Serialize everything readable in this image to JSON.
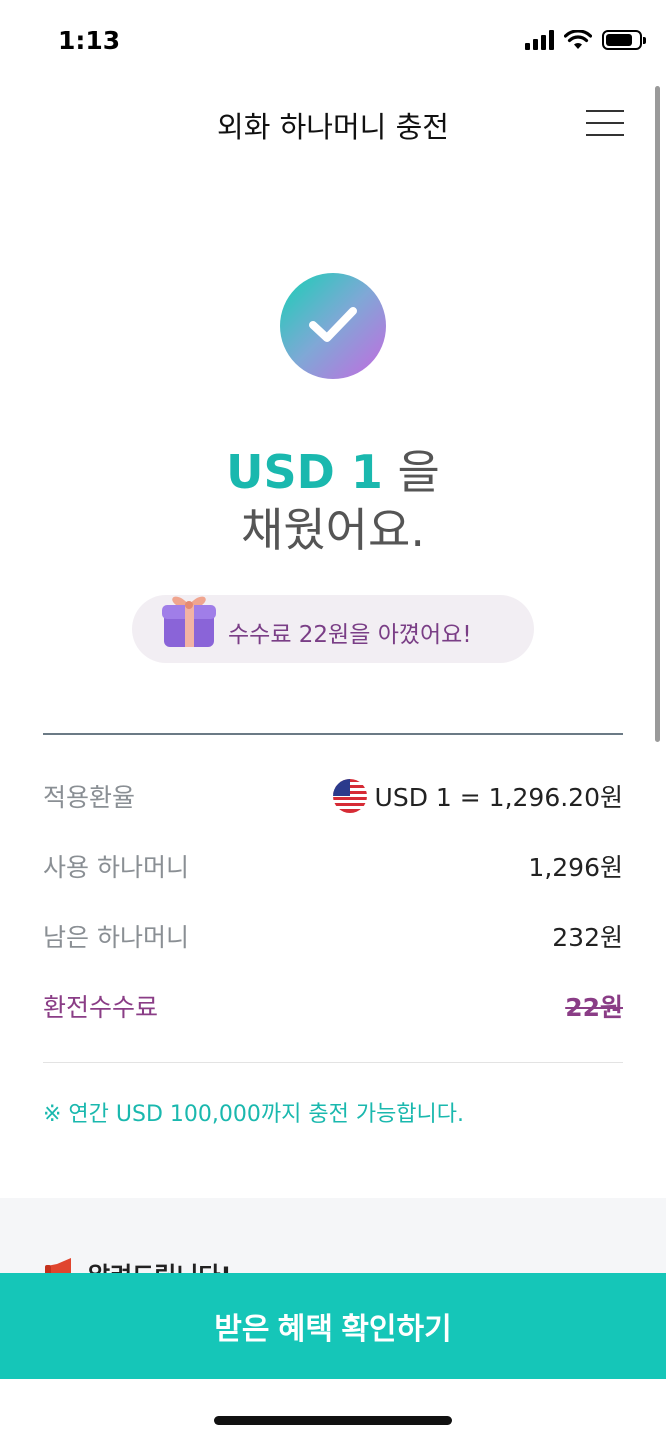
{
  "status_bar": {
    "time": "1:13",
    "battery_level": 0.8
  },
  "header": {
    "title": "외화 하나머니 충전"
  },
  "result": {
    "amount": "USD 1",
    "particle": "을",
    "message": "채웠어요."
  },
  "saving": {
    "text": "수수료 22원을 아꼈어요!"
  },
  "details": [
    {
      "label": "적용환율",
      "value": "USD 1 = 1,296.20원",
      "flag": "us"
    },
    {
      "label": "사용 하나머니",
      "value": "1,296원"
    },
    {
      "label": "남은 하나머니",
      "value": "232원"
    },
    {
      "label": "환전수수료",
      "value": "22원",
      "struck": true
    }
  ],
  "notice": "※ 연간 USD 100,000까지 충전 가능합니다.",
  "alert": {
    "title": "알려드립니다!"
  },
  "cta": {
    "label": "받은 혜택 확인하기"
  },
  "colors": {
    "accent": "#15c6b8",
    "purple": "#8a3d86"
  }
}
